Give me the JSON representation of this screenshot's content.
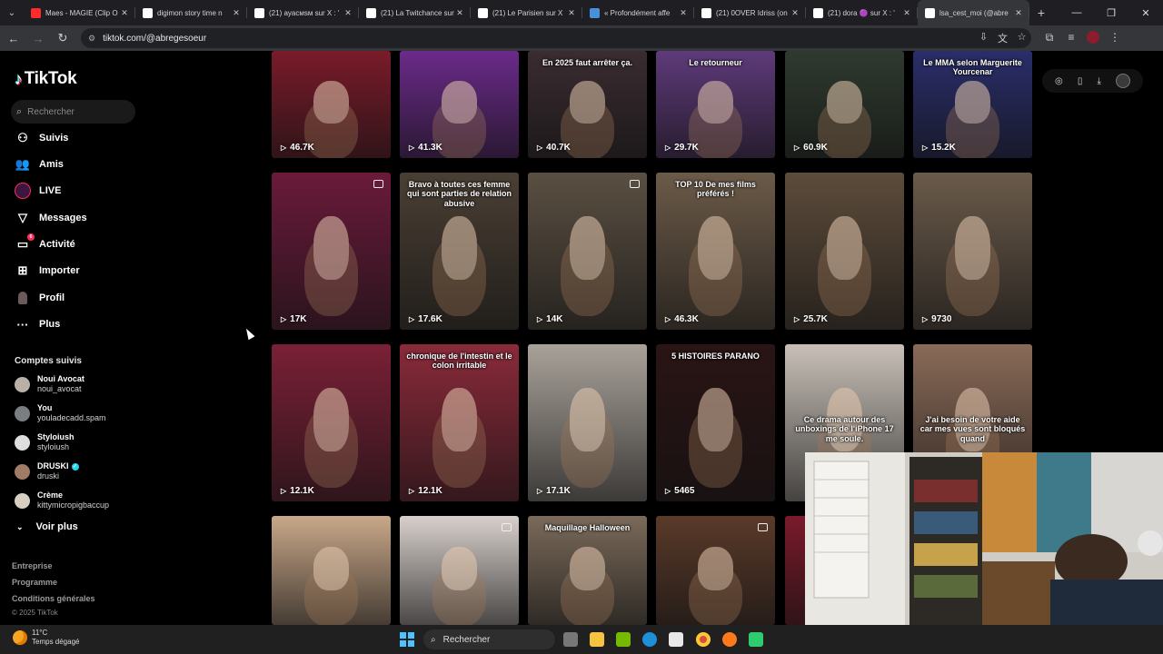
{
  "browser": {
    "tabs": [
      {
        "title": "Maes - MAGIE (Clip O",
        "favicon_color": "#ff2a2a",
        "favicon_icon": "youtube-icon",
        "active": false
      },
      {
        "title": "digimon story time n",
        "favicon_color": "#ffffff",
        "favicon_icon": "google-icon",
        "active": false
      },
      {
        "title": "(21) аyасмsм sur X : '",
        "favicon_color": "#ffffff",
        "favicon_icon": "x-icon",
        "active": false
      },
      {
        "title": "(21) La Twitchance sur",
        "favicon_color": "#ffffff",
        "favicon_icon": "x-icon",
        "active": false
      },
      {
        "title": "(21) Le Parisien sur X",
        "favicon_color": "#ffffff",
        "favicon_icon": "x-icon",
        "active": false
      },
      {
        "title": "« Profondément affe",
        "favicon_color": "#4a90d9",
        "favicon_icon": "news-icon",
        "active": false
      },
      {
        "title": "(21) 0OVER Idriss (on",
        "favicon_color": "#ffffff",
        "favicon_icon": "x-icon",
        "active": false
      },
      {
        "title": "(21) dora 🟣 sur X : '",
        "favicon_color": "#ffffff",
        "favicon_icon": "x-icon",
        "active": false
      },
      {
        "title": "lsa_cest_moi (@abre",
        "favicon_color": "#ffffff",
        "favicon_icon": "tiktok-icon",
        "active": true
      }
    ],
    "url": "tiktok.com/@abregesoeur"
  },
  "sidebar": {
    "brand": "TikTok",
    "search_placeholder": "Rechercher",
    "menu": [
      {
        "label": "Suivis",
        "icon": "following-icon"
      },
      {
        "label": "Amis",
        "icon": "friends-icon"
      },
      {
        "label": "LIVE",
        "icon": "live-icon"
      },
      {
        "label": "Messages",
        "icon": "messages-icon"
      },
      {
        "label": "Activité",
        "icon": "activity-icon",
        "badge": "6"
      },
      {
        "label": "Importer",
        "icon": "upload-icon"
      },
      {
        "label": "Profil",
        "icon": "profile-icon"
      },
      {
        "label": "Plus",
        "icon": "more-icon"
      }
    ],
    "following_title": "Comptes suivis",
    "accounts": [
      {
        "name": "Noui Avocat",
        "username": "noui_avocat",
        "avatar_color": "#b9b0a8"
      },
      {
        "name": "You",
        "username": "youladecadd.spam",
        "avatar_color": "#7b7e80"
      },
      {
        "name": "Styloiush",
        "username": "styloiush",
        "avatar_color": "#dedede"
      },
      {
        "name": "DRUSKI",
        "username": "druski",
        "avatar_color": "#a07b66",
        "verified": true
      },
      {
        "name": "Crème",
        "username": "kittymicropigbaccup",
        "avatar_color": "#d6cfc2"
      }
    ],
    "see_more": "Voir plus",
    "footer_links": [
      "Entreprise",
      "Programme",
      "Conditions générales"
    ],
    "copyright": "© 2025 TikTok"
  },
  "grid": {
    "rows": [
      [
        {
          "views": "46.7K",
          "bg": "#7a1b2a",
          "caption": ""
        },
        {
          "views": "41.3K",
          "bg": "#6b2a8a",
          "caption": ""
        },
        {
          "views": "40.7K",
          "bg": "#3a2c30",
          "caption": "En 2025 faut arrêter ça."
        },
        {
          "views": "29.7K",
          "bg": "#5e3a7a",
          "caption": "Le retourneur"
        },
        {
          "views": "60.9K",
          "bg": "#2f3a2f",
          "caption": ""
        },
        {
          "views": "15.2K",
          "bg": "#2a2e6a",
          "caption": "Le MMA selon Marguerite Yourcenar"
        }
      ],
      [
        {
          "views": "17K",
          "bg": "#6a1a3a",
          "caption": "",
          "multi": true
        },
        {
          "views": "17.6K",
          "bg": "#4a3f34",
          "caption": "Bravo à toutes ces femme qui sont parties de relation abusive"
        },
        {
          "views": "14K",
          "bg": "#5a4f42",
          "caption": "",
          "multi": true
        },
        {
          "views": "46.3K",
          "bg": "#6b5a48",
          "caption": "TOP 10 De mes films préférés !"
        },
        {
          "views": "25.7K",
          "bg": "#5d4c3b",
          "caption": ""
        },
        {
          "views": "9730",
          "bg": "#6a5a4a",
          "caption": ""
        }
      ],
      [
        {
          "views": "12.1K",
          "bg": "#7a2036",
          "caption": ""
        },
        {
          "views": "12.1K",
          "bg": "#8a2a3a",
          "caption": "chronique de l'intestin et le colon irritable"
        },
        {
          "views": "17.1K",
          "bg": "#a9a29a",
          "caption": ""
        },
        {
          "views": "5465",
          "bg": "#2a1414",
          "caption": "5 HISTOIRES PARANO"
        },
        {
          "views": "",
          "bg": "#c8c0b8",
          "caption": "Ce drama autour des unboxings de l'iPhone 17 me soule."
        },
        {
          "views": "",
          "bg": "#8a6a58",
          "caption": "J'ai besoin de votre aide car mes vues sont bloqués quand"
        }
      ],
      [
        {
          "views": "",
          "bg": "#c9a889",
          "caption": ""
        },
        {
          "views": "",
          "bg": "#d8d0cc",
          "caption": "",
          "multi": true
        },
        {
          "views": "",
          "bg": "#7a6a5a",
          "caption": "Maquillage Halloween"
        },
        {
          "views": "",
          "bg": "#5a3a2a",
          "caption": "",
          "multi": true
        },
        {
          "views": "",
          "bg": "#7a1a2a",
          "caption": ""
        }
      ]
    ]
  },
  "taskbar": {
    "temperature": "11°C",
    "weather": "Temps dégagé",
    "search": "Rechercher"
  }
}
